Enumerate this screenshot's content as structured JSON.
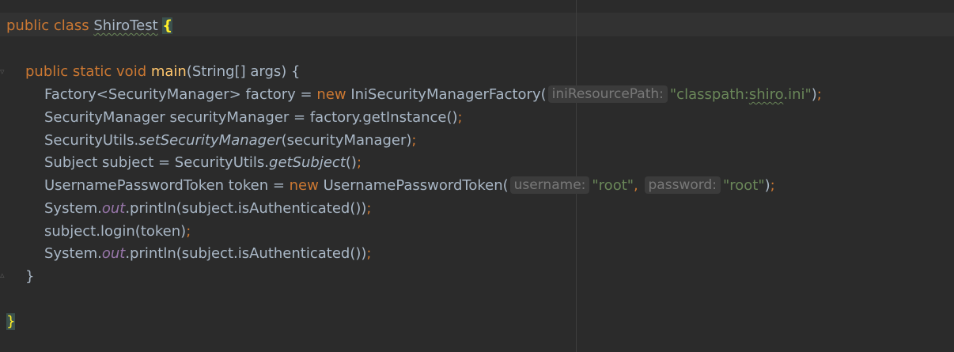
{
  "code": {
    "class_decl": {
      "kw_public": "public",
      "kw_class": "class",
      "class_name": "ShiroTest",
      "open_brace": "{"
    },
    "main_decl": {
      "modifiers": "public static void",
      "method_name": "main",
      "params": "(String[] args) {"
    },
    "line_factory": {
      "decl": "Factory<SecurityManager> factory = ",
      "kw_new": "new",
      "ctor": " IniSecurityManagerFactory(",
      "hint": "iniResourcePath:",
      "str_open": "\"classpath:",
      "str_word": "shiro",
      "str_close": ".ini\"",
      "close": ")",
      "semi": ";"
    },
    "line_manager": {
      "text": "SecurityManager securityManager = factory.getInstance()",
      "semi": ";"
    },
    "line_set_manager": {
      "prefix": "SecurityUtils.",
      "method": "setSecurityManager",
      "args": "(securityManager)",
      "semi": ";"
    },
    "line_subject": {
      "prefix": "Subject subject = SecurityUtils.",
      "method": "getSubject",
      "args": "()",
      "semi": ";"
    },
    "line_token": {
      "decl": "UsernamePasswordToken token = ",
      "kw_new": "new",
      "ctor": " UsernamePasswordToken(",
      "hint_username": "username:",
      "val_username": "\"root\"",
      "comma": ",",
      "hint_password": "password:",
      "val_password": "\"root\"",
      "close": ")",
      "semi": ";"
    },
    "line_print_1": {
      "prefix": "System.",
      "field": "out",
      "suffix": ".println(subject.isAuthenticated())",
      "semi": ";"
    },
    "line_login": {
      "text": "subject.login(token)",
      "semi": ";"
    },
    "line_print_2": {
      "prefix": "System.",
      "field": "out",
      "suffix": ".println(subject.isAuthenticated())",
      "semi": ";"
    },
    "method_close": "}",
    "class_close": "}"
  },
  "colors": {
    "background": "#2b2b2b",
    "keyword": "#cc7832",
    "method_decl": "#ffc66d",
    "string": "#6a8759",
    "static_field": "#9876aa",
    "default_text": "#a9b7c6"
  }
}
